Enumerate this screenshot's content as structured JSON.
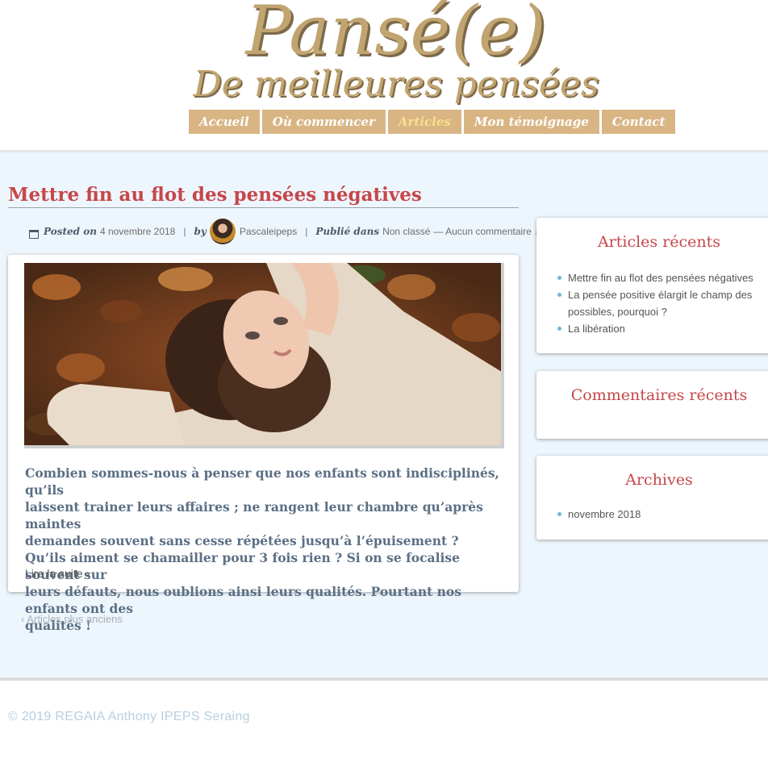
{
  "site": {
    "title": "Pansé(e)",
    "subtitle": "De meilleures pensées"
  },
  "nav": {
    "items": [
      {
        "label": "Accueil"
      },
      {
        "label": "Où commencer"
      },
      {
        "label": "Articles"
      },
      {
        "label": "Mon témoignage"
      },
      {
        "label": "Contact"
      }
    ],
    "active": "Articles"
  },
  "post": {
    "title": "Mettre fin au flot des pensées négatives",
    "posted_label": "Posted on",
    "date": "4 novembre 2018",
    "by_label": "by",
    "author": "Pascaleipeps",
    "published_label": "Publié dans",
    "category": "Non classé",
    "comments": "— Aucun commentaire ↓",
    "excerpt_lines": [
      "Combien sommes-nous à penser que nos enfants sont indisciplinés, qu’ils",
      "laissent trainer leurs affaires ; ne rangent leur chambre qu’après maintes",
      "demandes souvent sans cesse répétées jusqu’à l’épuisement ?",
      "Qu’ils aiment se chamailler pour 3 fois rien ? Si on se focalise souvent sur",
      "leurs défauts, nous oublions ainsi leurs qualités. Pourtant nos enfants ont des",
      "qualités !"
    ],
    "read_more": "Lire la suite ›"
  },
  "pagination": {
    "older": "‹ Articles plus anciens"
  },
  "sidebar": {
    "recent_posts": {
      "title": "Articles récents",
      "items": [
        "Mettre fin au flot des pensées négatives",
        "La pensée positive élargit le champ des possibles, pourquoi ?",
        "La libération"
      ]
    },
    "recent_comments": {
      "title": "Commentaires récents"
    },
    "archives": {
      "title": "Archives",
      "items": [
        "novembre 2018"
      ]
    }
  },
  "footer": {
    "text": "© 2019 REGAIA Anthony IPEPS Seraing"
  },
  "colors": {
    "brand_gold": "#c1a46f",
    "nav_bg": "#d9b584",
    "accent_red": "#c6474a",
    "main_bg": "#eef6fd"
  }
}
